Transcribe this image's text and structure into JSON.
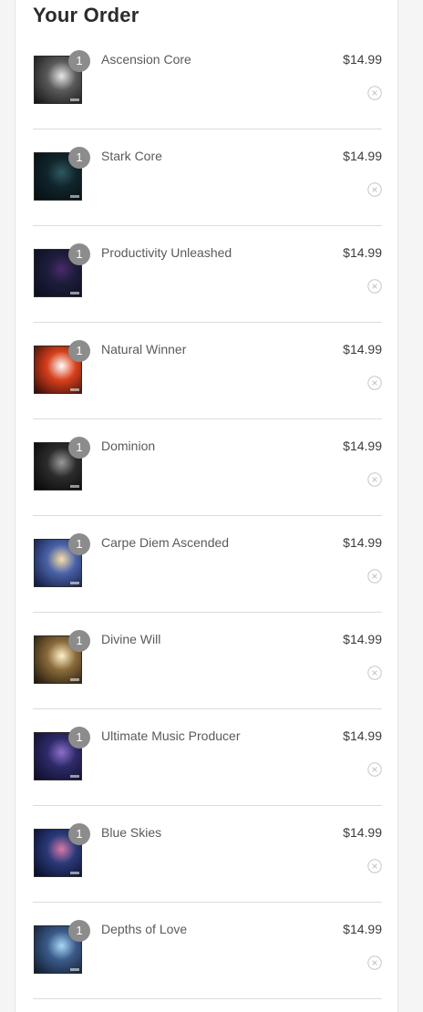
{
  "order": {
    "title": "Your Order",
    "items": [
      {
        "name": "Ascension Core",
        "price": "$14.99",
        "quantity": "1",
        "art": [
          "#e8e8e8",
          "#5a5a5a",
          "#111111"
        ]
      },
      {
        "name": "Stark Core",
        "price": "$14.99",
        "quantity": "1",
        "art": [
          "#2f5860",
          "#10252c",
          "#050d10"
        ]
      },
      {
        "name": "Productivity Unleashed",
        "price": "$14.99",
        "quantity": "1",
        "art": [
          "#4a2a6a",
          "#1c1d3a",
          "#0c0d1c"
        ]
      },
      {
        "name": "Natural Winner",
        "price": "$14.99",
        "quantity": "1",
        "art": [
          "#ffffff",
          "#d8401c",
          "#2a0a08"
        ]
      },
      {
        "name": "Dominion",
        "price": "$14.99",
        "quantity": "1",
        "art": [
          "#9a9a9a",
          "#2c2c2c",
          "#050505"
        ]
      },
      {
        "name": "Carpe Diem Ascended",
        "price": "$14.99",
        "quantity": "1",
        "art": [
          "#f8e0a8",
          "#4a62a8",
          "#0e1638"
        ]
      },
      {
        "name": "Divine Will",
        "price": "$14.99",
        "quantity": "1",
        "art": [
          "#fff2c8",
          "#8a6a3a",
          "#1a120c"
        ]
      },
      {
        "name": "Ultimate Music Producer",
        "price": "$14.99",
        "quantity": "1",
        "art": [
          "#8c70c8",
          "#2e2a6a",
          "#0c0c22"
        ]
      },
      {
        "name": "Blue Skies",
        "price": "$14.99",
        "quantity": "1",
        "art": [
          "#d87aa8",
          "#2a3a7a",
          "#060a20"
        ]
      },
      {
        "name": "Depths of Love",
        "price": "$14.99",
        "quantity": "1",
        "art": [
          "#a8d8f8",
          "#3a5a8a",
          "#101828"
        ]
      }
    ]
  }
}
